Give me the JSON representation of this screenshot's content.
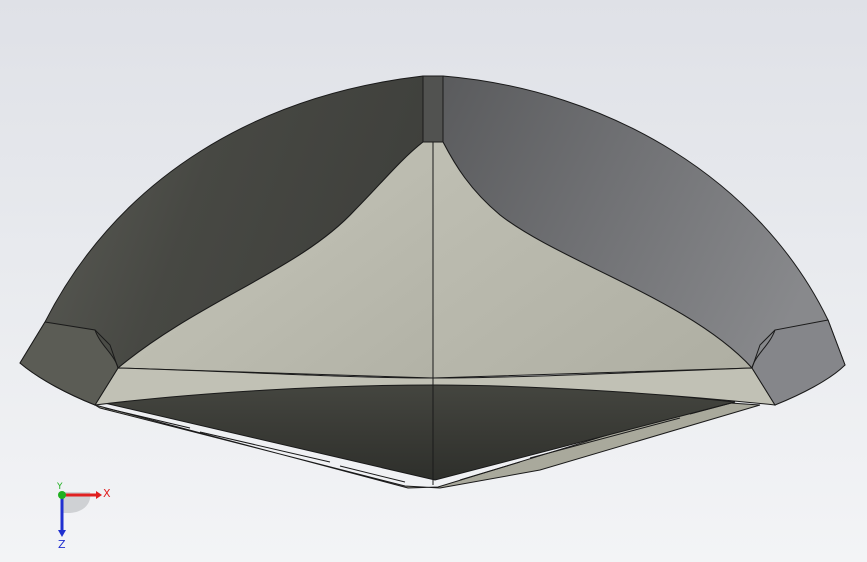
{
  "viewport": {
    "background_top": "#dfe1e7",
    "background_bottom": "#f3f4f6"
  },
  "model": {
    "name": "",
    "shaded": true,
    "edges_visible": true,
    "colors": {
      "outer_dark": "#4a4b47",
      "outer_light": "#7a7b7f",
      "inner_face": "#bcbcb0",
      "underside": "#3e3f3a",
      "edge": "#1a1a1a"
    }
  },
  "triad": {
    "x_label": "X",
    "y_label": "Y",
    "z_label": "Z",
    "x_color": "#e02020",
    "y_color": "#20b020",
    "z_color": "#2030d0"
  }
}
